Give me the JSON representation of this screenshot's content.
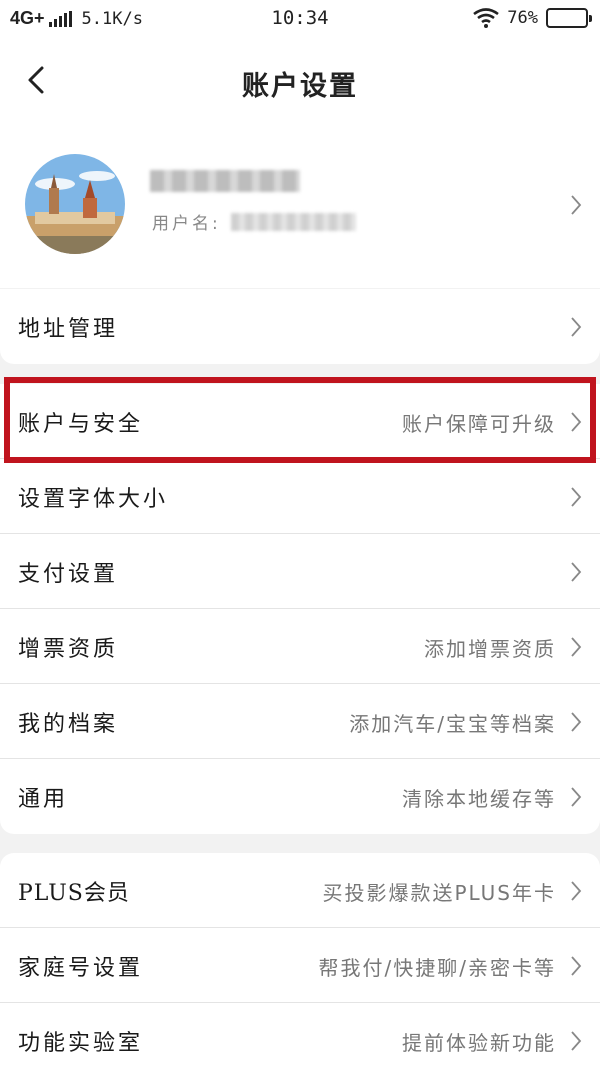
{
  "status_bar": {
    "network": "4G+",
    "speed": "5.1K/s",
    "time": "10:34",
    "battery": "76%",
    "battery_level": 0.76
  },
  "header": {
    "title": "账户设置"
  },
  "profile": {
    "username_label": "用户名:"
  },
  "address": {
    "label": "地址管理"
  },
  "settings": [
    {
      "label": "账户与安全",
      "hint": "账户保障可升级"
    },
    {
      "label": "设置字体大小",
      "hint": ""
    },
    {
      "label": "支付设置",
      "hint": ""
    },
    {
      "label": "增票资质",
      "hint": "添加增票资质"
    },
    {
      "label": "我的档案",
      "hint": "添加汽车/宝宝等档案"
    },
    {
      "label": "通用",
      "hint": "清除本地缓存等"
    }
  ],
  "extras": [
    {
      "label": "PLUS会员",
      "hint": "买投影爆款送PLUS年卡"
    },
    {
      "label": "家庭号设置",
      "hint": "帮我付/快捷聊/亲密卡等"
    },
    {
      "label": "功能实验室",
      "hint": "提前体验新功能"
    }
  ],
  "colors": {
    "highlight": "#c0141e",
    "page_bg": "#f2f2f2"
  }
}
